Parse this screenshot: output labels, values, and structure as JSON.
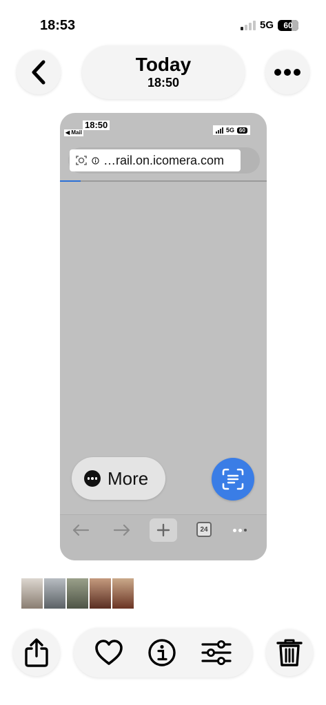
{
  "status_bar": {
    "time": "18:53",
    "network": "5G",
    "battery": "60",
    "signal_bars_filled": 1
  },
  "header": {
    "title": "Today",
    "subtitle": "18:50"
  },
  "screenshot": {
    "status_bar": {
      "time": "18:50",
      "back_app": "◀ Mail",
      "network": "5G",
      "battery": "60"
    },
    "address_bar": {
      "url": "…rail.on.icomera.com",
      "load_progress": 0.1
    },
    "more_button": {
      "label": "More"
    },
    "toolbar": {
      "tab_count": "24"
    }
  },
  "thumbnails": [
    {
      "name": "thumb-1",
      "colors": [
        "#dcd6cf",
        "#8a7e72"
      ]
    },
    {
      "name": "thumb-2",
      "colors": [
        "#b7bcc1",
        "#5c6266"
      ]
    },
    {
      "name": "thumb-3",
      "colors": [
        "#9aa08a",
        "#4e5446"
      ]
    },
    {
      "name": "thumb-4",
      "colors": [
        "#c49a7e",
        "#5a2e22"
      ]
    },
    {
      "name": "thumb-5",
      "colors": [
        "#caa98a",
        "#6b3424"
      ]
    }
  ],
  "colors": {
    "accent": "#3a7de6",
    "pill_bg": "#f4f4f4",
    "screenshot_bg": "#c0c0c0"
  }
}
